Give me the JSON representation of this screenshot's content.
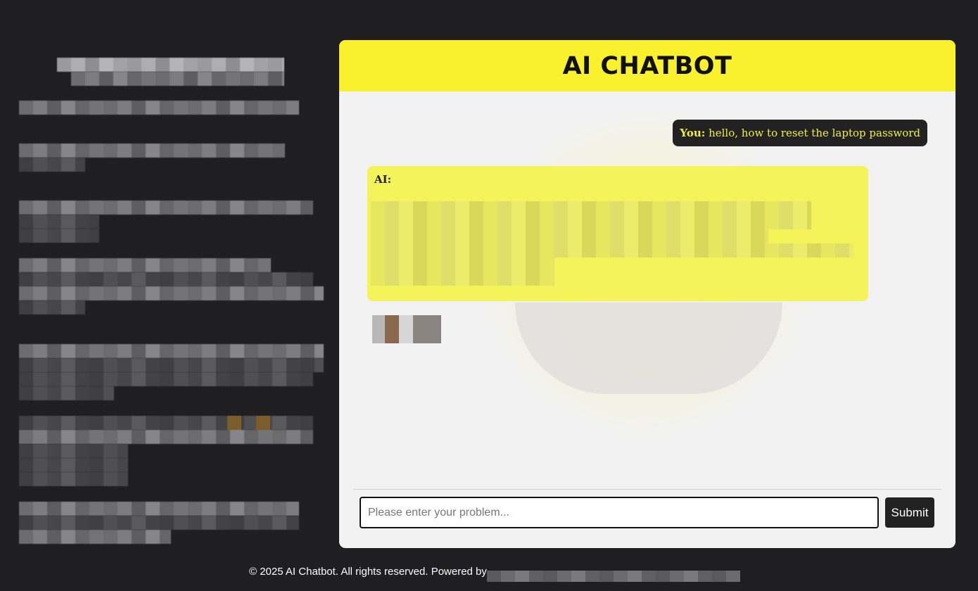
{
  "chat": {
    "title": "AI CHATBOT",
    "messages": [
      {
        "role_label": "You:",
        "text": "hello, how to reset the laptop password"
      },
      {
        "role_label": "AI:",
        "text": ""
      }
    ]
  },
  "input": {
    "placeholder": "Please enter your problem...",
    "value": "",
    "submit_label": "Submit"
  },
  "footer": {
    "text": "© 2025 AI Chatbot. All rights reserved. Powered by"
  },
  "colors": {
    "page_background": "#1f1f21",
    "header_accent": "#f9f12e",
    "ai_bubble": "#f4f45a",
    "user_bubble": "#222222",
    "user_text": "#f4ee3c"
  }
}
